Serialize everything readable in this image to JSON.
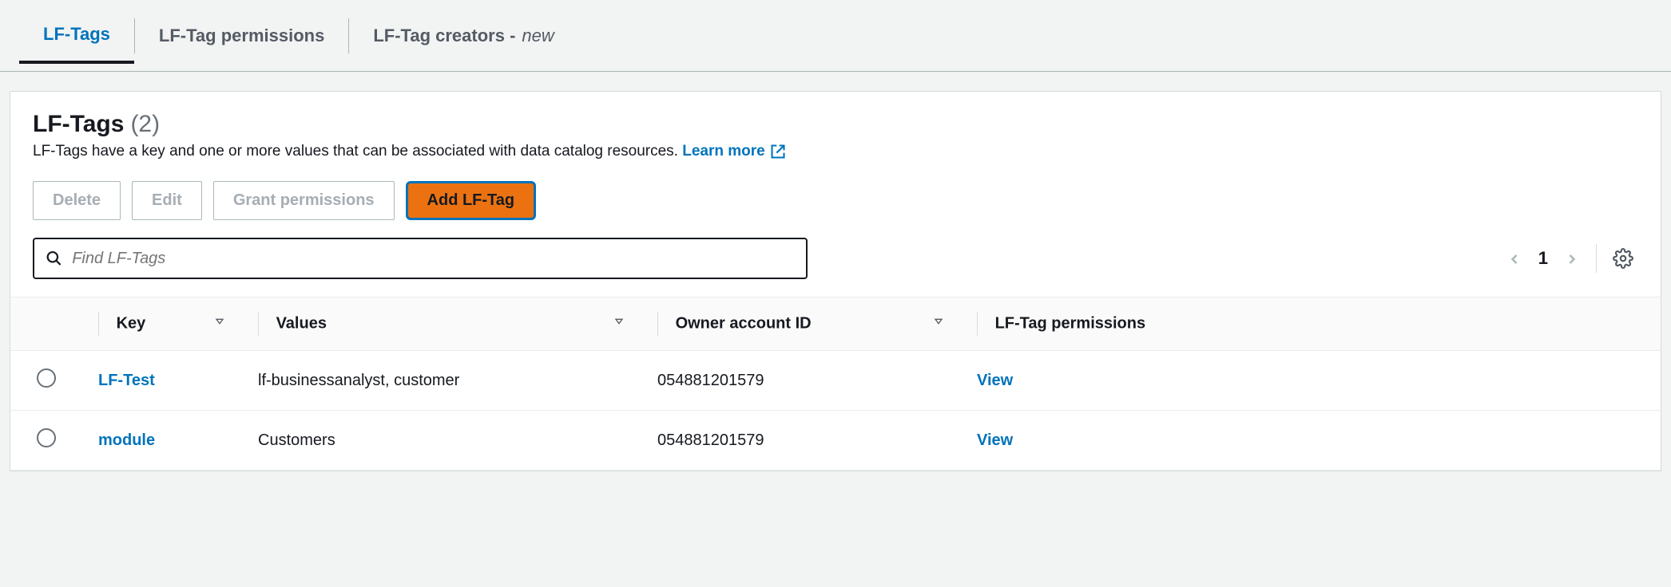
{
  "tabs": {
    "lftags": "LF-Tags",
    "permissions": "LF-Tag permissions",
    "creators": "LF-Tag creators -",
    "creators_new": "new"
  },
  "header": {
    "title": "LF-Tags",
    "count": "(2)",
    "description": "LF-Tags have a key and one or more values that can be associated with data catalog resources.",
    "learn_more": "Learn more"
  },
  "buttons": {
    "delete": "Delete",
    "edit": "Edit",
    "grant": "Grant permissions",
    "add": "Add LF-Tag"
  },
  "search": {
    "placeholder": "Find LF-Tags"
  },
  "pager": {
    "page": "1"
  },
  "columns": {
    "key": "Key",
    "values": "Values",
    "owner": "Owner account ID",
    "permissions": "LF-Tag permissions"
  },
  "rows": [
    {
      "key": "LF-Test",
      "values": "lf-businessanalyst, customer",
      "owner": "054881201579",
      "view": "View"
    },
    {
      "key": "module",
      "values": "Customers",
      "owner": "054881201579",
      "view": "View"
    }
  ]
}
